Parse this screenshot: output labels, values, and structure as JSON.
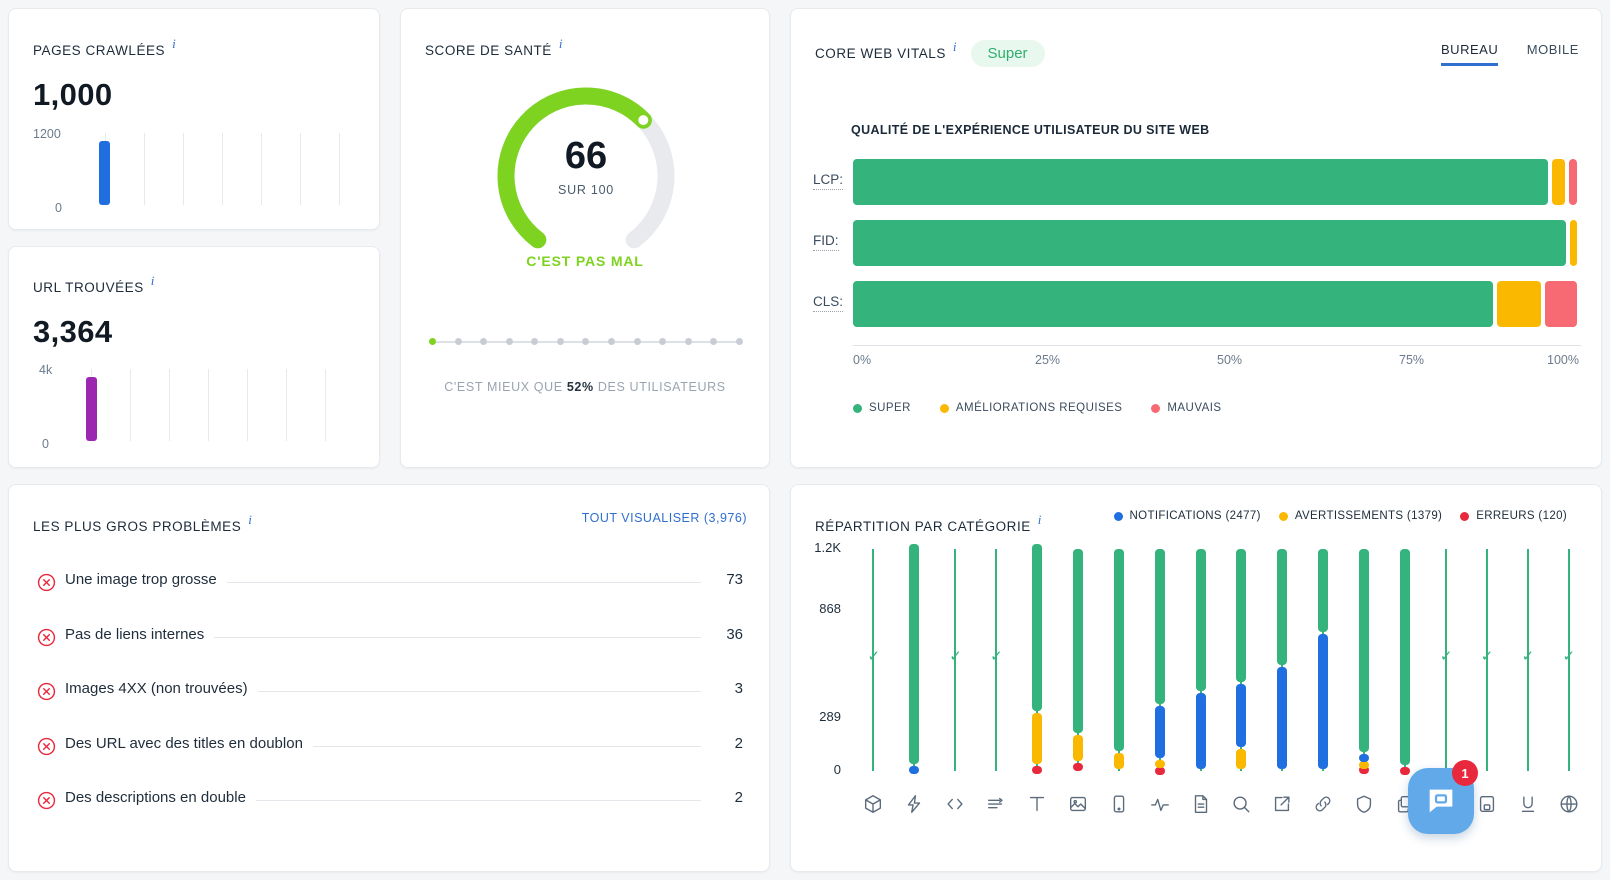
{
  "cards": {
    "crawled": {
      "title": "PAGES CRAWLÉES",
      "value": "1,000",
      "y_top": "1200",
      "y_bottom": "0",
      "bar_color": "#1f6fe0"
    },
    "urls": {
      "title": "URL TROUVÉES",
      "value": "3,364",
      "y_top": "4k",
      "y_bottom": "0",
      "bar_color": "#9b27b0"
    },
    "health": {
      "title": "SCORE DE SANTÉ",
      "score": "66",
      "score_sub": "SUR 100",
      "verdict": "C'EST PAS MAL",
      "percentile_prefix": "C'EST MIEUX QUE ",
      "percentile_value": "52%",
      "percentile_suffix": " DES UTILISATEURS",
      "gauge_color": "#7ed321",
      "gauge_pct": 66
    },
    "cwv": {
      "title": "CORE WEB VITALS",
      "badge": "Super",
      "subtitle": "QUALITÉ DE L'EXPÉRIENCE UTILISATEUR DU SITE WEB",
      "tabs": [
        {
          "label": "BUREAU",
          "active": true
        },
        {
          "label": "MOBILE",
          "active": false
        }
      ],
      "axis_ticks": [
        "0%",
        "25%",
        "50%",
        "75%",
        "100%"
      ],
      "legend": [
        {
          "label": "SUPER",
          "color": "#34b37c"
        },
        {
          "label": "AMÉLIORATIONS REQUISES",
          "color": "#fbb800"
        },
        {
          "label": "MAUVAIS",
          "color": "#f76a73"
        }
      ],
      "rows": [
        {
          "key": "LCP:",
          "good": 96.0,
          "needs": 2.3,
          "poor": 1.7
        },
        {
          "key": "FID:",
          "good": 98.5,
          "needs": 1.5,
          "poor": 0.0
        },
        {
          "key": "CLS:",
          "good": 88.5,
          "needs": 6.5,
          "poor": 5.0
        }
      ]
    },
    "issues": {
      "title": "LES PLUS GROS PROBLÈMES",
      "view_all": "TOUT VISUALISER (3,976)",
      "items": [
        {
          "name": "Une image trop grosse",
          "value": "73"
        },
        {
          "name": "Pas de liens internes",
          "value": "36"
        },
        {
          "name": "Images 4XX (non trouvées)",
          "value": "3"
        },
        {
          "name": "Des URL avec des titles en doublon",
          "value": "2"
        },
        {
          "name": "Des descriptions en double",
          "value": "2"
        }
      ]
    },
    "category": {
      "title": "RÉPARTITION PAR CATÉGORIE",
      "legend": [
        {
          "label": "NOTIFICATIONS (2477)",
          "color": "#1f6fe0"
        },
        {
          "label": "AVERTISSEMENTS (1379)",
          "color": "#fbb800"
        },
        {
          "label": "ERREURS (120)",
          "color": "#e8283c"
        }
      ]
    }
  },
  "chat": {
    "badge_count": "1",
    "icon": "chat-bubble-icon"
  },
  "chart_data": {
    "type": "bar",
    "title": "RÉPARTITION PAR CATÉGORIE",
    "stacked": true,
    "ylabel": "",
    "xlabel": "",
    "ylim": [
      0,
      1200
    ],
    "ytick_labels": [
      "0",
      "289",
      "868",
      "1.2K"
    ],
    "ytick_values": [
      0,
      289,
      868,
      1200
    ],
    "grid": false,
    "legend_position": "top-right",
    "series": [
      {
        "name": "NOTIFICATIONS",
        "color": "#1f6fe0",
        "total": 2477
      },
      {
        "name": "AVERTISSEMENTS",
        "color": "#fbb800",
        "total": 1379
      },
      {
        "name": "ERREURS",
        "color": "#e8283c",
        "total": 120
      }
    ],
    "categories": [
      "cube-icon",
      "bolt-icon",
      "code-icon",
      "filter-icon",
      "text-icon",
      "image-icon",
      "mobile-icon",
      "pulse-icon",
      "document-icon",
      "search-icon",
      "external-link-icon",
      "link-icon",
      "shield-icon",
      "copy-icon",
      "redirect-icon",
      "markup-icon",
      "underline-icon",
      "globe-icon"
    ],
    "bars": [
      {
        "category": "cube-icon",
        "ok": true,
        "notifications": 0,
        "warnings": 0,
        "errors": 0
      },
      {
        "category": "bolt-icon",
        "ok": false,
        "notifications": 25,
        "warnings": 0,
        "errors": 0,
        "green": 1200
      },
      {
        "category": "code-icon",
        "ok": true,
        "notifications": 0,
        "warnings": 0,
        "errors": 0
      },
      {
        "category": "filter-icon",
        "ok": true,
        "notifications": 0,
        "warnings": 0,
        "errors": 0
      },
      {
        "category": "text-icon",
        "ok": false,
        "notifications": 0,
        "warnings": 290,
        "errors": 25,
        "green": 910
      },
      {
        "category": "image-icon",
        "ok": false,
        "notifications": 0,
        "warnings": 150,
        "errors": 45,
        "green": 1005
      },
      {
        "category": "mobile-icon",
        "ok": false,
        "notifications": 0,
        "warnings": 95,
        "errors": 0,
        "green": 1105
      },
      {
        "category": "pulse-icon",
        "ok": false,
        "notifications": 290,
        "warnings": 40,
        "errors": 20,
        "green": 850
      },
      {
        "category": "document-icon",
        "ok": false,
        "notifications": 420,
        "warnings": 0,
        "errors": 0,
        "green": 780
      },
      {
        "category": "search-icon",
        "ok": false,
        "notifications": 350,
        "warnings": 120,
        "errors": 0,
        "green": 730
      },
      {
        "category": "external-link-icon",
        "ok": false,
        "notifications": 560,
        "warnings": 0,
        "errors": 0,
        "green": 640
      },
      {
        "category": "link-icon",
        "ok": false,
        "notifications": 740,
        "warnings": 0,
        "errors": 0,
        "green": 460
      },
      {
        "category": "shield-icon",
        "ok": false,
        "notifications": 35,
        "warnings": 30,
        "errors": 25,
        "green": 1110
      },
      {
        "category": "copy-icon",
        "ok": false,
        "notifications": 0,
        "warnings": 0,
        "errors": 22,
        "green": 1178
      },
      {
        "category": "redirect-icon",
        "ok": true,
        "notifications": 0,
        "warnings": 0,
        "errors": 0
      },
      {
        "category": "markup-icon",
        "ok": true,
        "notifications": 0,
        "warnings": 0,
        "errors": 0
      },
      {
        "category": "underline-icon",
        "ok": true,
        "notifications": 0,
        "warnings": 0,
        "errors": 0
      },
      {
        "category": "globe-icon",
        "ok": true,
        "notifications": 0,
        "warnings": 0,
        "errors": 0
      }
    ]
  }
}
